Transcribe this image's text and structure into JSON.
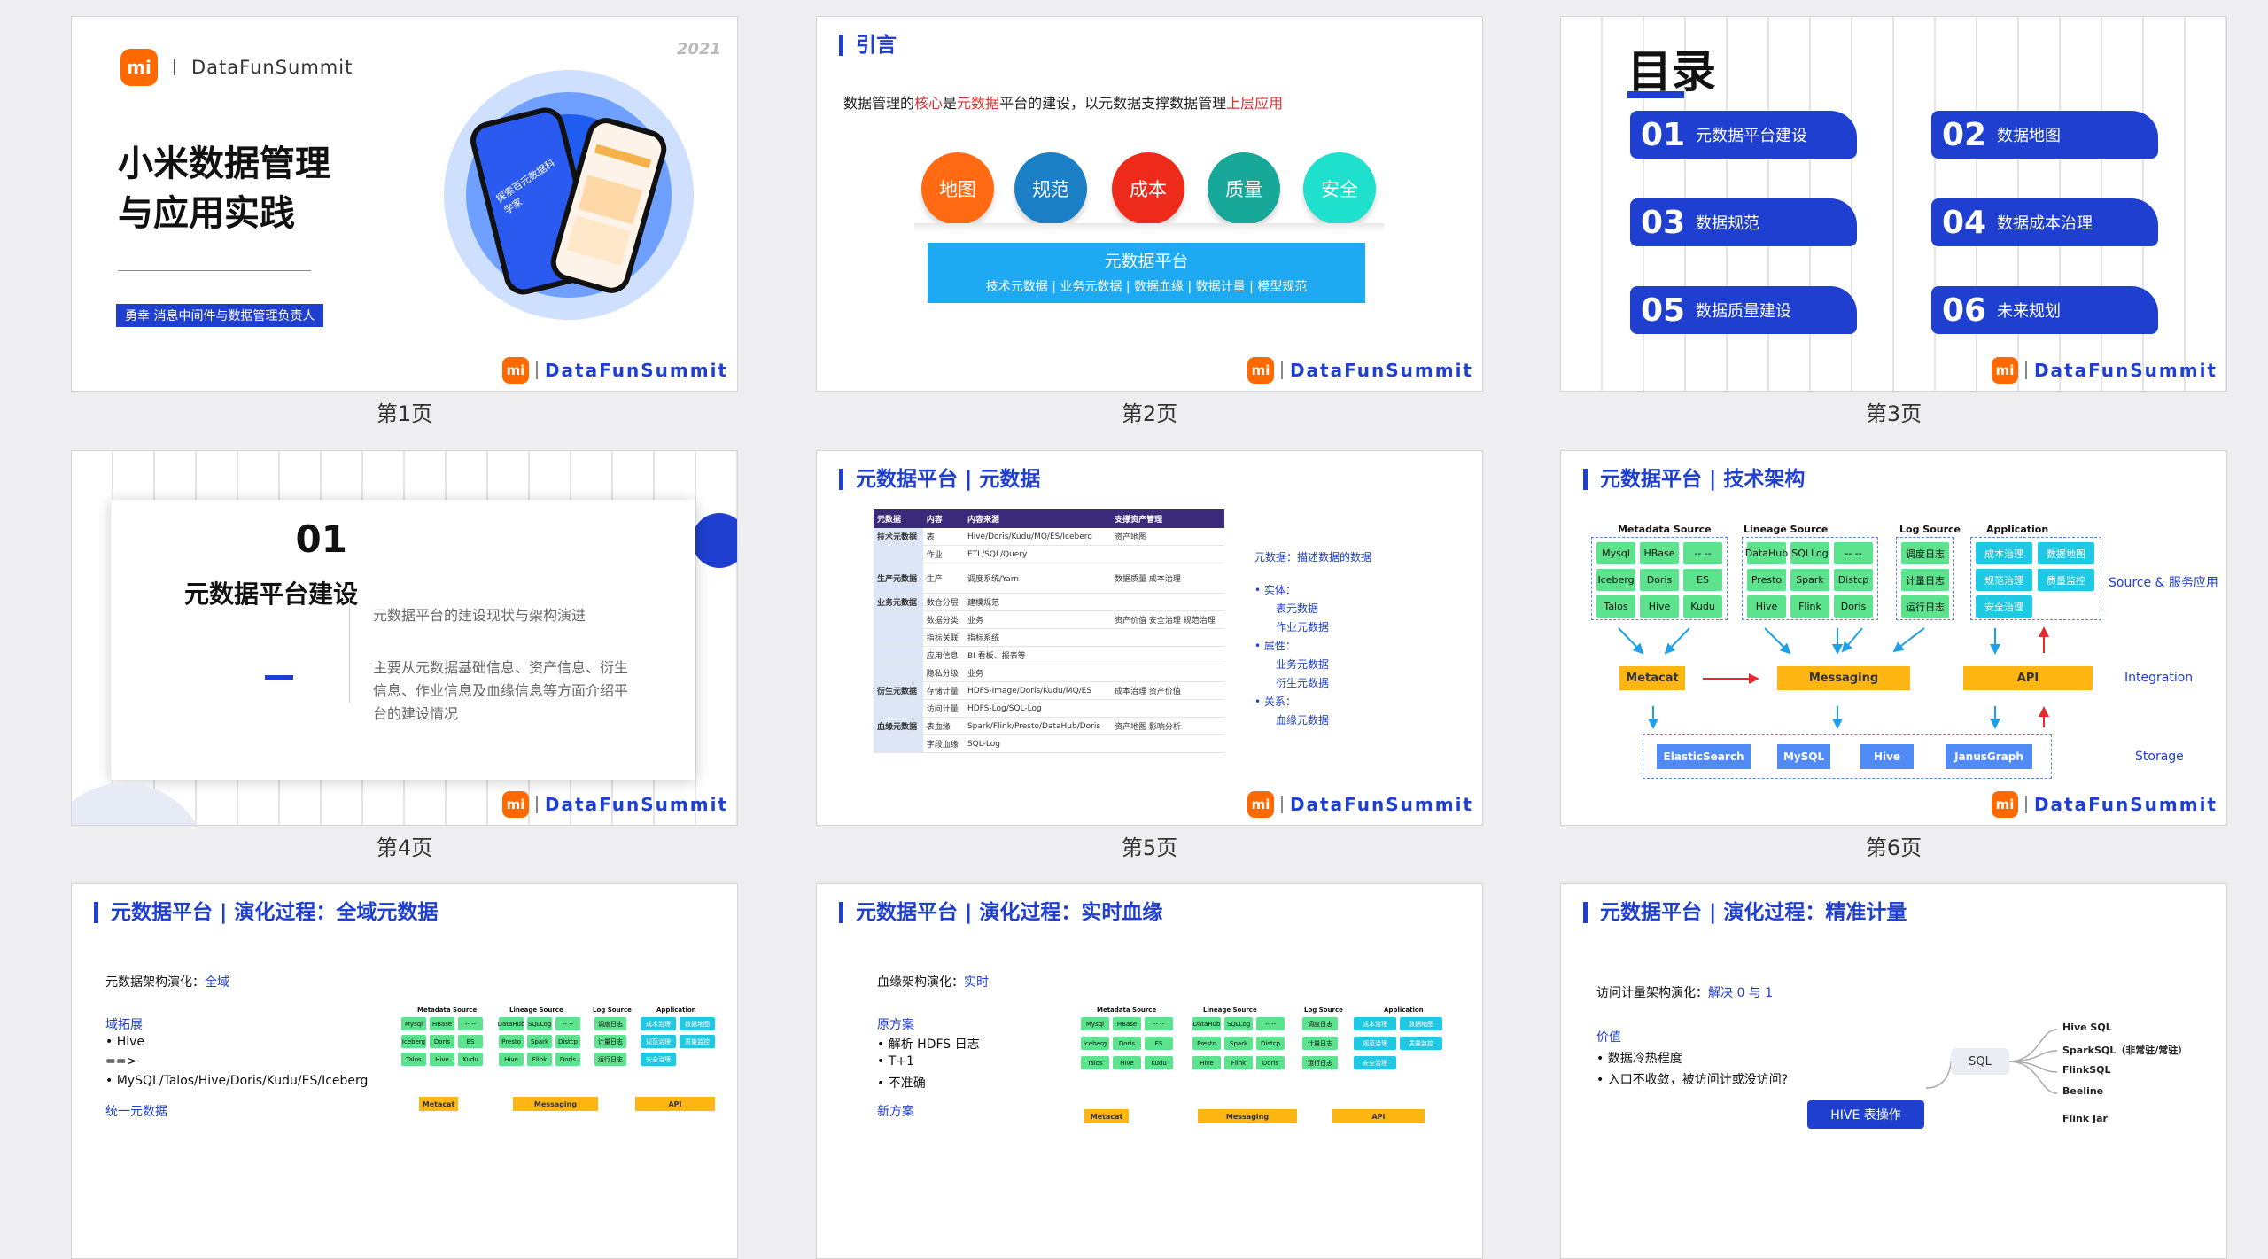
{
  "colors": {
    "brand_blue": "#1e3fcf",
    "mi_orange": "#ff6900"
  },
  "footer": {
    "logo": "mi",
    "brand": "DataFunSummit"
  },
  "captions": [
    "第1页",
    "第2页",
    "第3页",
    "第4页",
    "第5页",
    "第6页",
    "第7页",
    "第8页",
    "第9页"
  ],
  "s1": {
    "logo_text": "DataFunSummit",
    "year": "2021",
    "title_l1": "小米数据管理",
    "title_l2": "与应用实践",
    "author": "勇幸  消息中间件与数据管理负责人",
    "phone_text": "探索百元数据科学家"
  },
  "s2": {
    "title": "引言",
    "sub_a": "数据管理的",
    "sub_b": "核心",
    "sub_c": "是",
    "sub_d": "元数据",
    "sub_e": "平台的建设，以元数据支撑数据管理",
    "sub_f": "上层应用",
    "circles": [
      "地图",
      "规范",
      "成本",
      "质量",
      "安全"
    ],
    "base_title": "元数据平台",
    "base_sub": "技术元数据 | 业务元数据 | 数据血缘 | 数据计量 | 模型规范"
  },
  "s3": {
    "title": "目录",
    "items": [
      {
        "n": "01",
        "l": "元数据平台建设"
      },
      {
        "n": "02",
        "l": "数据地图"
      },
      {
        "n": "03",
        "l": "数据规范"
      },
      {
        "n": "04",
        "l": "数据成本治理"
      },
      {
        "n": "05",
        "l": "数据质量建设"
      },
      {
        "n": "06",
        "l": "未来规划"
      }
    ]
  },
  "s4": {
    "num": "01",
    "label": "元数据平台建设",
    "t1": "元数据平台的建设现状与架构演进",
    "t2": "主要从元数据基础信息、资产信息、衍生信息、作业信息及血缘信息等方面介绍平台的建设情况"
  },
  "s5": {
    "title": "元数据平台 | 元数据",
    "headers": [
      "元数据",
      "内容",
      "内容来源",
      "支撑资产管理"
    ],
    "rows": [
      [
        "技术元数据",
        "表",
        "Hive/Doris/Kudu/MQ/ES/Iceberg",
        "资产地图"
      ],
      [
        "",
        "作业",
        "ETL/SQL/Query",
        ""
      ],
      [
        "生产元数据",
        "生产",
        "调度系统/Yarn",
        "数据质量 成本治理"
      ],
      [
        "业务元数据",
        "数仓分层",
        "建模规范",
        ""
      ],
      [
        "",
        "数据分类",
        "业务",
        "资产价值 安全治理 规范治理"
      ],
      [
        "",
        "指标关联",
        "指标系统",
        ""
      ],
      [
        "",
        "应用信息",
        "BI 看板、报表等",
        ""
      ],
      [
        "",
        "隐私分级",
        "业务",
        ""
      ],
      [
        "衍生元数据",
        "存储计量",
        "HDFS-Image/Doris/Kudu/MQ/ES",
        "成本治理 资产价值"
      ],
      [
        "",
        "访问计量",
        "HDFS-Log/SQL-Log",
        ""
      ],
      [
        "血缘元数据",
        "表血缘",
        "Spark/Flink/Presto/DataHub/Doris",
        "资产地图 影响分析"
      ],
      [
        "",
        "字段血缘",
        "SQL-Log",
        ""
      ]
    ],
    "side_title": "元数据：描述数据的数据",
    "side": [
      "• 实体：",
      "表元数据",
      "作业元数据",
      "• 属性：",
      "业务元数据",
      "衍生元数据",
      "• 关系：",
      "血缘元数据"
    ]
  },
  "s6": {
    "title": "元数据平台 | 技术架构",
    "heads": [
      "Metadata Source",
      "Lineage Source",
      "Log Source",
      "Application"
    ],
    "meta": [
      "Mysql",
      "HBase",
      "-- --",
      "Iceberg",
      "Doris",
      "ES",
      "Talos",
      "Hive",
      "Kudu"
    ],
    "lineage": [
      "DataHub",
      "SQLLog",
      "-- --",
      "Presto",
      "Spark",
      "Distcp",
      "Hive",
      "Flink",
      "Doris"
    ],
    "log": [
      "调度日志",
      "计量日志",
      "运行日志"
    ],
    "app": [
      "成本治理",
      "数据地图",
      "规范治理",
      "质量监控",
      "安全治理"
    ],
    "mid": [
      "Metacat",
      "Messaging",
      "API"
    ],
    "storage": [
      "ElasticSearch",
      "MySQL",
      "Hive",
      "JanusGraph"
    ],
    "side": [
      "Source & 服务应用",
      "Integration",
      "Storage"
    ]
  },
  "s7": {
    "title": "元数据平台 | 演化过程：全域元数据",
    "l1a": "元数据架构演化：",
    "l1b": "全域",
    "l2": "域拓展",
    "l3": "• Hive",
    "l4": "==>",
    "l5": "• MySQL/Talos/Hive/Doris/Kudu/ES/Iceberg",
    "l6": "统一元数据"
  },
  "s8": {
    "title": "元数据平台 | 演化过程：实时血缘",
    "l1a": "血缘架构演化：",
    "l1b": "实时",
    "l2": "原方案",
    "l3": "• 解析 HDFS 日志",
    "l4": "• T+1",
    "l5": "• 不准确",
    "l6": "新方案"
  },
  "s9": {
    "title": "元数据平台 | 演化过程：精准计量",
    "l1a": "访问计量架构演化：",
    "l1b": "解决 0 与 1",
    "l2": "价值",
    "l3": "• 数据冷热程度",
    "l4": "• 入口不收敛，被访问计或没访问?",
    "sql": "SQL",
    "hive_btn": "HIVE 表操作",
    "tree": [
      "Hive SQL",
      "SparkSQL（非常驻/常驻）",
      "FlinkSQL",
      "Beeline",
      "Flink Jar"
    ]
  }
}
